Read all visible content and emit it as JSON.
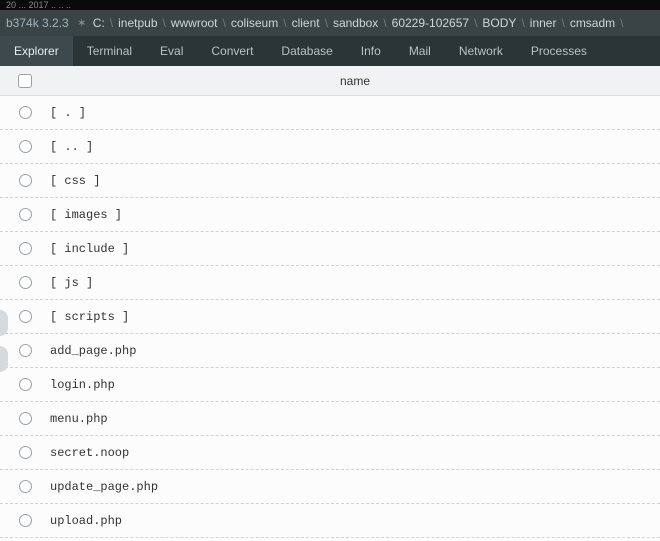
{
  "topbar": "        20 ...     2017 ..  .. ..",
  "header": {
    "version": "b374k 3.2.3",
    "root": "C:",
    "crumbs": [
      "inetpub",
      "wwwroot",
      "coliseum",
      "client",
      "sandbox",
      "60229-102657",
      "BODY",
      "inner",
      "cmsadm"
    ]
  },
  "tabs": [
    {
      "label": "Explorer",
      "active": true
    },
    {
      "label": "Terminal",
      "active": false
    },
    {
      "label": "Eval",
      "active": false
    },
    {
      "label": "Convert",
      "active": false
    },
    {
      "label": "Database",
      "active": false
    },
    {
      "label": "Info",
      "active": false
    },
    {
      "label": "Mail",
      "active": false
    },
    {
      "label": "Network",
      "active": false
    },
    {
      "label": "Processes",
      "active": false
    }
  ],
  "columns": {
    "name": "name"
  },
  "files": [
    {
      "name": "[ . ]"
    },
    {
      "name": "[ .. ]"
    },
    {
      "name": "[ css ]"
    },
    {
      "name": "[ images ]"
    },
    {
      "name": "[ include ]"
    },
    {
      "name": "[ js ]"
    },
    {
      "name": "[ scripts ]"
    },
    {
      "name": "add_page.php"
    },
    {
      "name": "login.php"
    },
    {
      "name": "menu.php"
    },
    {
      "name": "secret.noop"
    },
    {
      "name": "update_page.php"
    },
    {
      "name": "upload.php"
    }
  ]
}
